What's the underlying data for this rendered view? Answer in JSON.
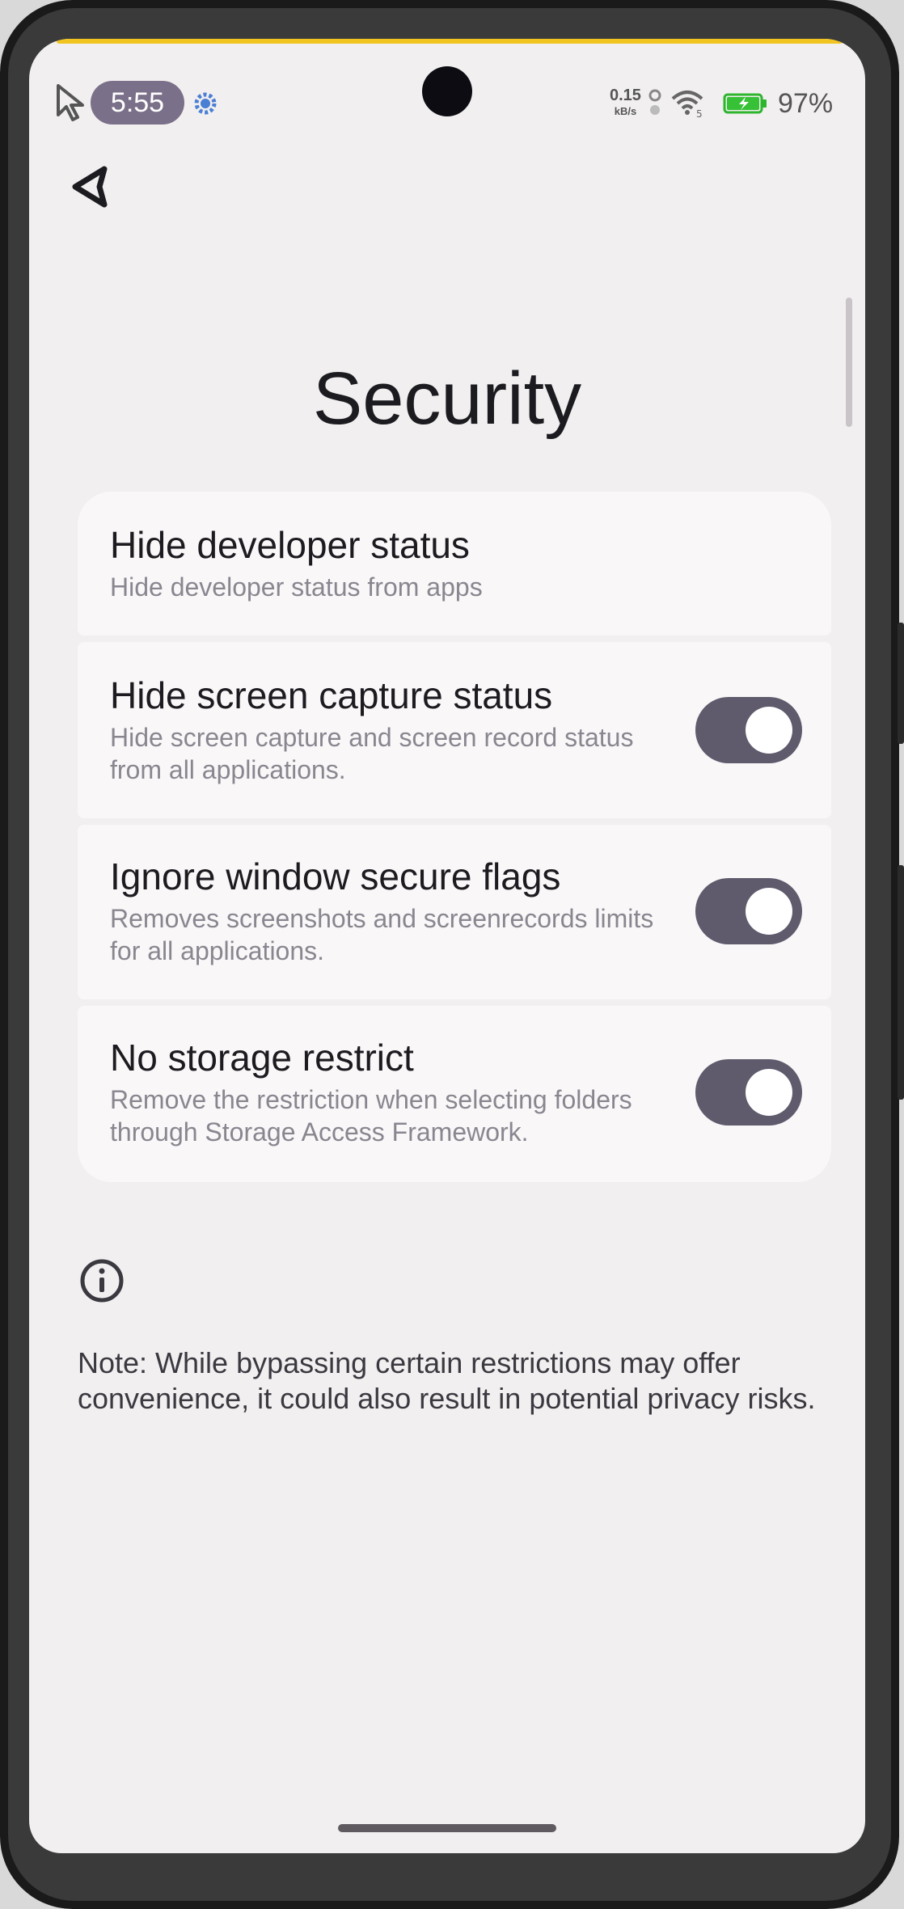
{
  "status_bar": {
    "time": "5:55",
    "net_speed_value": "0.15",
    "net_speed_unit": "kB/s",
    "wifi_badge": "5",
    "battery": "97%"
  },
  "page": {
    "title": "Security"
  },
  "settings": [
    {
      "title": "Hide developer status",
      "description": "Hide developer status from apps",
      "has_toggle": false
    },
    {
      "title": "Hide screen capture status",
      "description": "Hide screen capture and screen record status from all applications.",
      "has_toggle": true,
      "enabled": true
    },
    {
      "title": "Ignore window secure flags",
      "description": "Removes screenshots and screenrecords limits for all applications.",
      "has_toggle": true,
      "enabled": true
    },
    {
      "title": "No storage restrict",
      "description": "Remove the restriction when selecting folders through Storage Access Framework.",
      "has_toggle": true,
      "enabled": true
    }
  ],
  "note": "Note: While bypassing certain restrictions may offer convenience, it could also result in potential privacy risks.",
  "colors": {
    "background": "#f2eff0",
    "card": "#faf7f8",
    "toggle_track": "#5f5a6c",
    "time_pill": "#7b7089",
    "accent_line": "#f2c420"
  },
  "icons": [
    "cursor-icon",
    "gear-icon",
    "wifi-icon",
    "battery-icon",
    "back-arrow-icon",
    "info-icon"
  ]
}
